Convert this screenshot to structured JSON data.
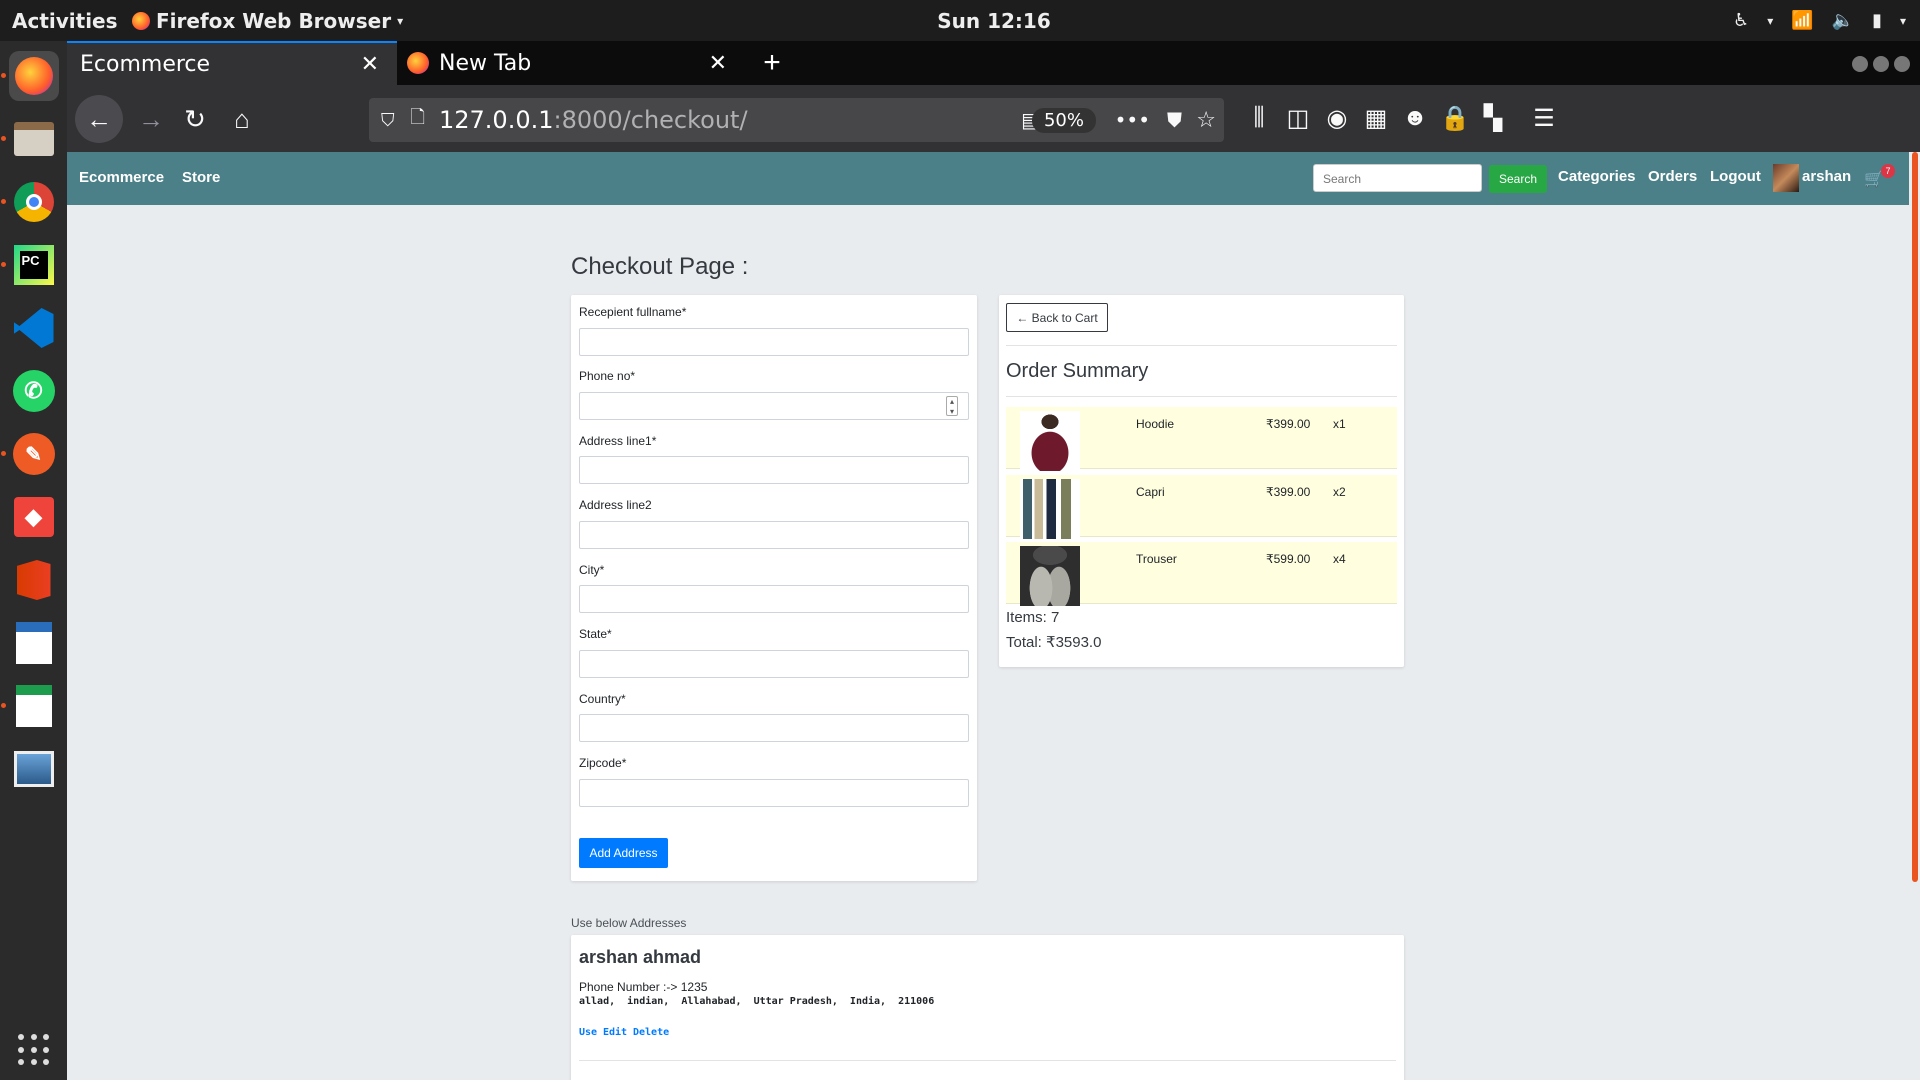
{
  "topbar": {
    "activities": "Activities",
    "app_name": "Firefox Web Browser",
    "clock": "Sun 12:16"
  },
  "dock": {
    "items": [
      "firefox",
      "files",
      "chrome",
      "pycharm",
      "vscode",
      "whatsapp",
      "postman",
      "anydesk",
      "office",
      "writer",
      "calc",
      "image-viewer"
    ]
  },
  "browser": {
    "tabs": [
      {
        "label": "Ecommerce",
        "active": true
      },
      {
        "label": "New Tab",
        "active": false
      }
    ],
    "url_host": "127.0.0.1",
    "url_path": ":8000/checkout/",
    "zoom": "50%"
  },
  "site": {
    "brand": "Ecommerce",
    "store": "Store",
    "search_placeholder": "Search",
    "search_button": "Search",
    "categories": "Categories",
    "orders": "Orders",
    "logout": "Logout",
    "username": "arshan",
    "cart_count": "7"
  },
  "checkout": {
    "title": "Checkout Page :",
    "fields": [
      {
        "label": "Recepient fullname*"
      },
      {
        "label": "Phone no*"
      },
      {
        "label": "Address line1*"
      },
      {
        "label": "Address line2"
      },
      {
        "label": "City*"
      },
      {
        "label": "State*"
      },
      {
        "label": "Country*"
      },
      {
        "label": "Zipcode*"
      }
    ],
    "add_button": "Add Address"
  },
  "summary": {
    "back_button": "← Back to Cart",
    "title": "Order Summary",
    "items": [
      {
        "name": "Hoodie",
        "price": "₹399.00",
        "qty": "x1"
      },
      {
        "name": "Capri",
        "price": "₹399.00",
        "qty": "x2"
      },
      {
        "name": "Trouser",
        "price": "₹599.00",
        "qty": "x4"
      }
    ],
    "items_count": "Items: 7",
    "total": "Total: ₹3593.0"
  },
  "addresses": {
    "caption": "Use below Addresses",
    "list": [
      {
        "name": "arshan ahmad",
        "phone": "Phone Number :-> 1235",
        "line": "allad,  indian,  Allahabad,  Uttar Pradesh,  India,  211006",
        "use": "Use",
        "edit": "Edit",
        "delete": "Delete"
      }
    ]
  },
  "colors": {
    "site_nav": "#4c8088",
    "primary": "#007bff",
    "success": "#28a745",
    "row_highlight": "#ffffe0"
  }
}
